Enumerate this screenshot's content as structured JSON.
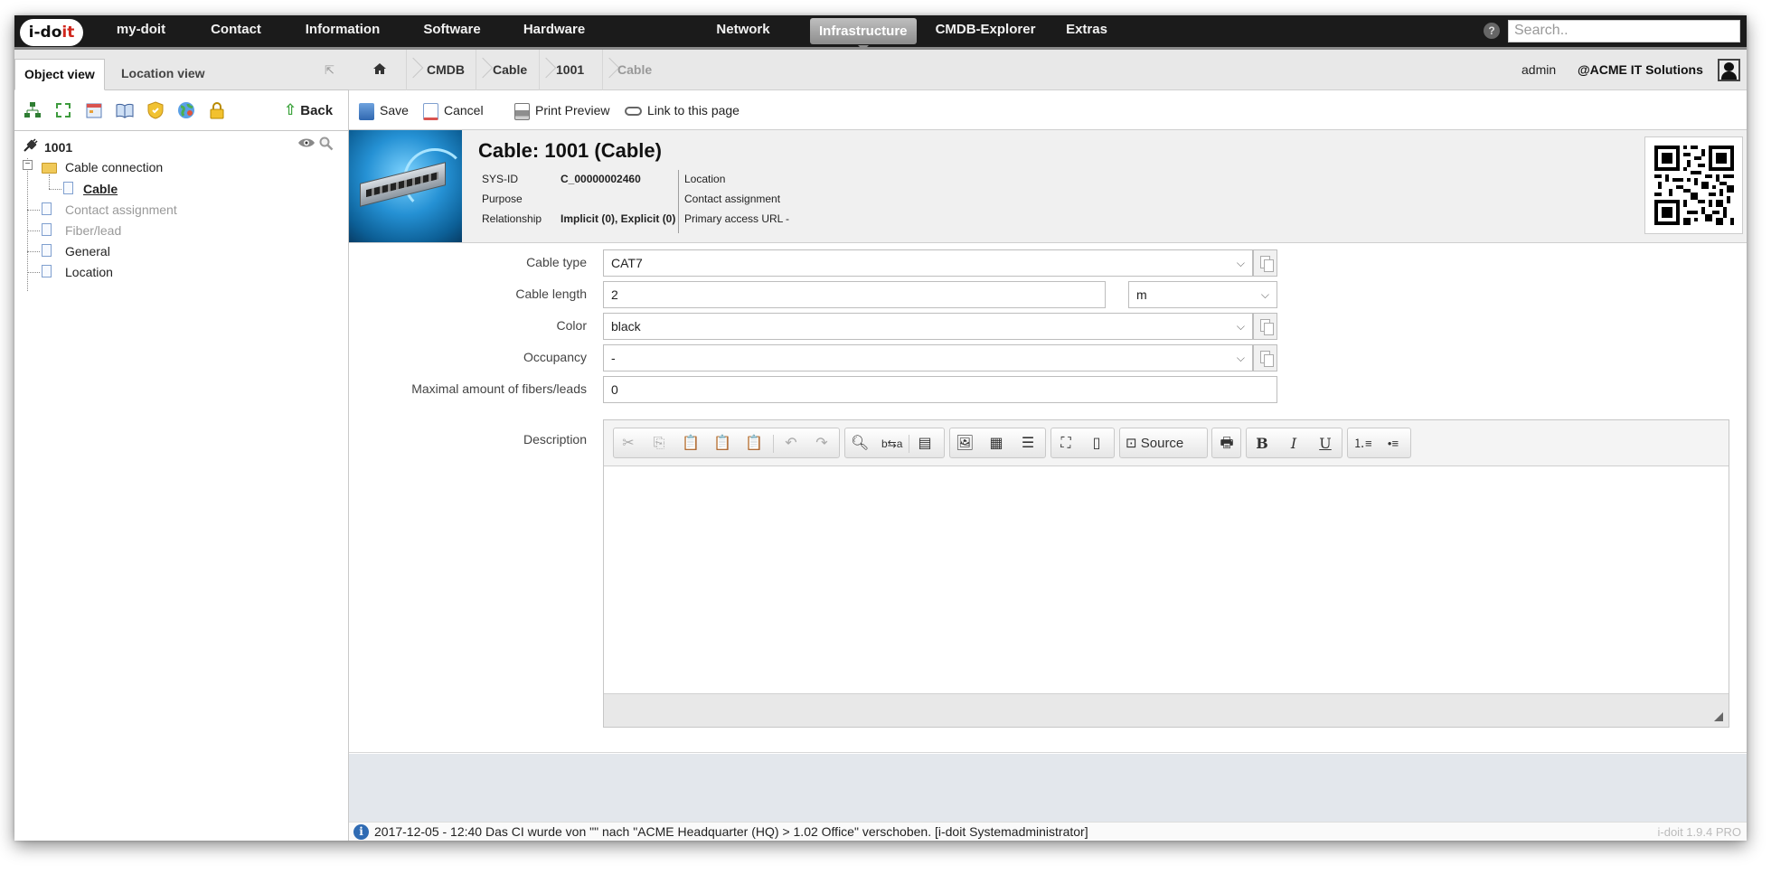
{
  "topnav": {
    "logo": {
      "main": "i-do",
      "accent": "it"
    },
    "items": [
      "my-doit",
      "Contact",
      "Information",
      "Software",
      "Hardware",
      "Network",
      "Infrastructure",
      "CMDB-Explorer",
      "Extras"
    ],
    "active": "Infrastructure",
    "search_placeholder": "Search.."
  },
  "left": {
    "tabs": [
      "Object view",
      "Location view"
    ],
    "back_label": "Back",
    "tree": {
      "root": "1001",
      "folder": "Cable connection",
      "selected": "Cable",
      "items": [
        "Contact assignment",
        "Fiber/lead",
        "General",
        "Location"
      ]
    }
  },
  "breadcrumb": [
    "CMDB",
    "Cable",
    "1001",
    "Cable"
  ],
  "user": {
    "name": "admin",
    "org": "@ACME IT Solutions"
  },
  "actions": {
    "save": "Save",
    "cancel": "Cancel",
    "print": "Print Preview",
    "link": "Link to this page"
  },
  "object": {
    "title": "Cable: 1001 (Cable)",
    "sysid_label": "SYS-ID",
    "sysid": "C_00000002460",
    "purpose_label": "Purpose",
    "relationship_label": "Relationship",
    "relationship": "Implicit (0), Explicit (0)",
    "location_label": "Location",
    "contact_label": "Contact assignment",
    "url_label": "Primary access URL",
    "url": "-"
  },
  "form": {
    "cable_type": {
      "label": "Cable type",
      "value": "CAT7"
    },
    "cable_length": {
      "label": "Cable length",
      "value": "2",
      "unit": "m"
    },
    "color": {
      "label": "Color",
      "value": "black"
    },
    "occupancy": {
      "label": "Occupancy",
      "value": "-"
    },
    "max_fibers": {
      "label": "Maximal amount of fibers/leads",
      "value": "0"
    },
    "description": {
      "label": "Description",
      "source_label": "Source"
    }
  },
  "status": {
    "message": "2017-12-05 - 12:40 Das CI wurde von \"\" nach \"ACME Headquarter (HQ) > 1.02 Office\" verschoben. [i-doit Systemadministrator]",
    "version": "i-doit 1.9.4 PRO"
  }
}
